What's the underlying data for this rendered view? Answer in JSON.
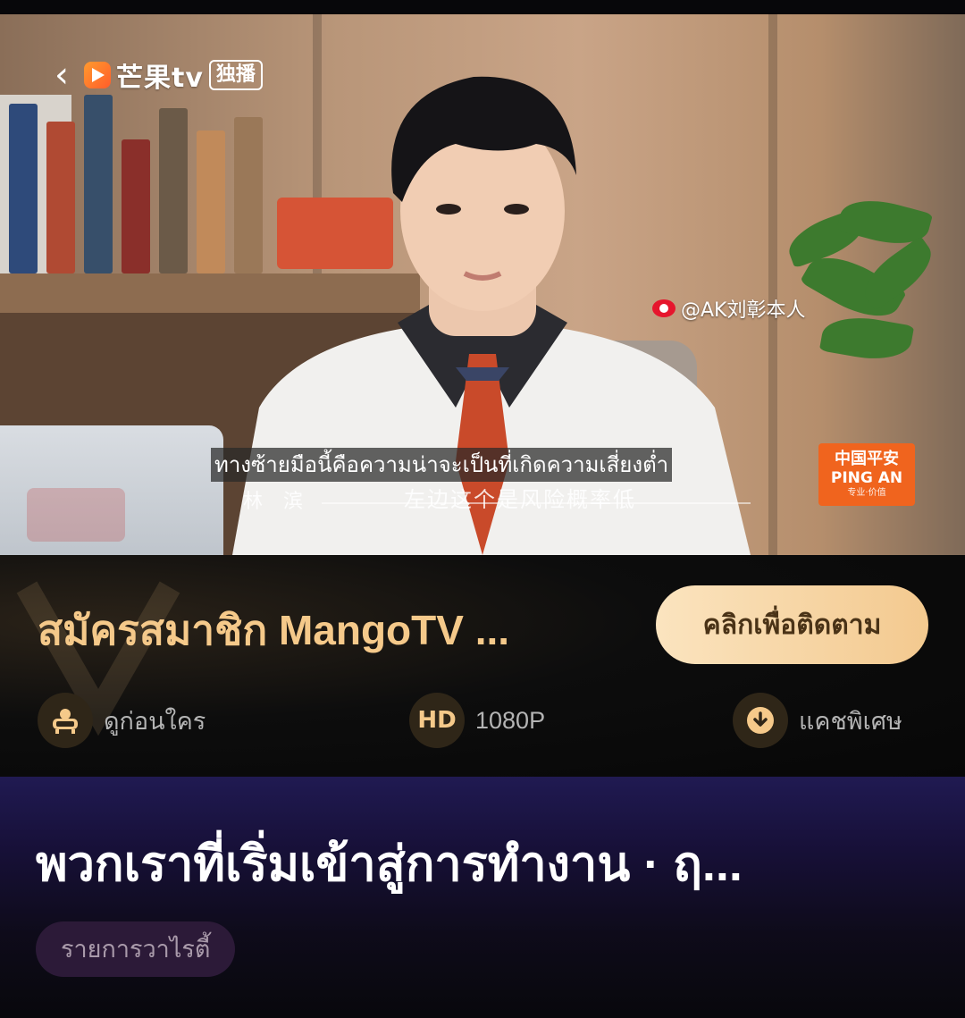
{
  "video": {
    "logo_brand": "芒果tv",
    "logo_badge": "独播",
    "weibo_handle": "@AK刘彰本人",
    "sponsor": {
      "line1": "中国平安",
      "line2": "PING AN",
      "line3": "专业·价值"
    },
    "subtitle_thai": "ทางซ้ายมือนี้คือความน่าจะเป็นที่เกิดความเสี่ยงต่ำ",
    "subtitle_name": "林 滨",
    "subtitle_chinese": "左边这个是风险概率低"
  },
  "vip": {
    "title": "สมัครสมาชิก MangoTV ...",
    "follow_button": "คลิกเพื่อติดตาม",
    "perks": [
      {
        "icon": "sofa-icon",
        "label": "ดูก่อนใคร"
      },
      {
        "icon": "hd-icon",
        "icon_text": "HD",
        "label": "1080P"
      },
      {
        "icon": "download-icon",
        "label": "แคชพิเศษ"
      }
    ],
    "accent_color": "#f5c98a"
  },
  "show": {
    "title": "พวกเราที่เริ่มเข้าสู่การทำงาน · ฤ...",
    "tag": "รายการวาไรตี้"
  }
}
